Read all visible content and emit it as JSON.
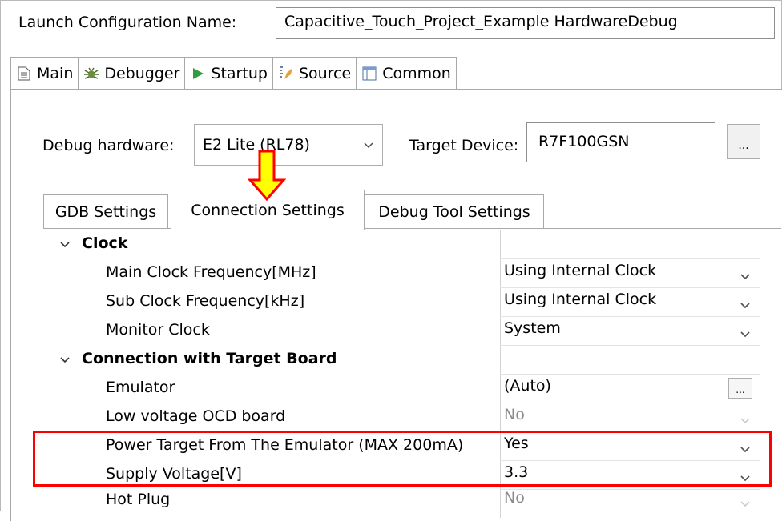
{
  "launch_config": {
    "label": "Launch Configuration Name:",
    "value": "Capacitive_Touch_Project_Example HardwareDebug"
  },
  "main_tabs": [
    {
      "label": "Main",
      "icon": "document-icon"
    },
    {
      "label": "Debugger",
      "icon": "bug-icon"
    },
    {
      "label": "Startup",
      "icon": "play-icon"
    },
    {
      "label": "Source",
      "icon": "source-icon"
    },
    {
      "label": "Common",
      "icon": "window-icon"
    }
  ],
  "debugger": {
    "hardware_label": "Debug hardware:",
    "hardware_value": "E2 Lite (RL78)",
    "target_label": "Target Device:",
    "target_value": "R7F100GSN",
    "browse_label": "..."
  },
  "inner_tabs": [
    "GDB Settings",
    "Connection Settings",
    "Debug Tool Settings"
  ],
  "properties": [
    {
      "name": "Clock",
      "category": true
    },
    {
      "name": "Main Clock Frequency[MHz]",
      "value": "Using Internal Clock"
    },
    {
      "name": "Sub Clock Frequency[kHz]",
      "value": "Using Internal Clock"
    },
    {
      "name": "Monitor Clock",
      "value": "System"
    },
    {
      "name": "Connection with Target Board",
      "category": true
    },
    {
      "name": "Emulator",
      "value": "(Auto)",
      "button": "..."
    },
    {
      "name": "Low voltage OCD board",
      "value": "No",
      "disabled": true
    },
    {
      "name": "Power Target From The Emulator (MAX 200mA)",
      "value": "Yes"
    },
    {
      "name": "Supply Voltage[V]",
      "value": "3.3"
    },
    {
      "name": "Hot Plug",
      "value": "No",
      "disabled": true
    }
  ],
  "colors": {
    "highlight": "#ff0000",
    "arrow": "#ffff00",
    "arrow_outline": "#ff0000"
  }
}
